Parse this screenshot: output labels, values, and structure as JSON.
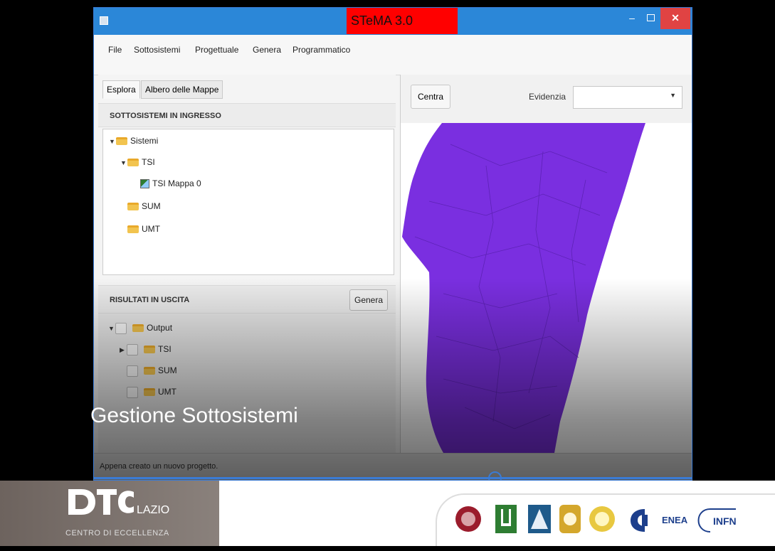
{
  "window": {
    "title": "STeMA 3.0",
    "minimize": "–",
    "close": "✕"
  },
  "menu": [
    "File",
    "Sottosistemi",
    "Progettuale",
    "Genera",
    "Programmatico"
  ],
  "tabs": [
    "Esplora",
    "Albero delle Mappe"
  ],
  "inputs_section": {
    "header": "SOTTOSISTEMI IN INGRESSO",
    "tree": [
      "Sistemi",
      "TSI",
      "TSI Mappa 0",
      "SUM",
      "UMT"
    ]
  },
  "outputs_section": {
    "header": "RISULTATI IN USCITA",
    "button": "Genera",
    "tree": [
      "Output",
      "TSI",
      "SUM",
      "UMT"
    ]
  },
  "map_panel": {
    "center_button": "Centra",
    "highlight_label": "Evidenzia",
    "highlight_value": "",
    "map_color": "#7a2fe0"
  },
  "status": "Appena creato un nuovo progetto.",
  "video": {
    "caption": "Gestione Sottosistemi",
    "progress": 0.67
  },
  "footer": {
    "logo_lazio": "LAZIO",
    "subtitle": "CENTRO DI ECCELLENZA",
    "enea": "ENEA",
    "infn": "INFN"
  }
}
